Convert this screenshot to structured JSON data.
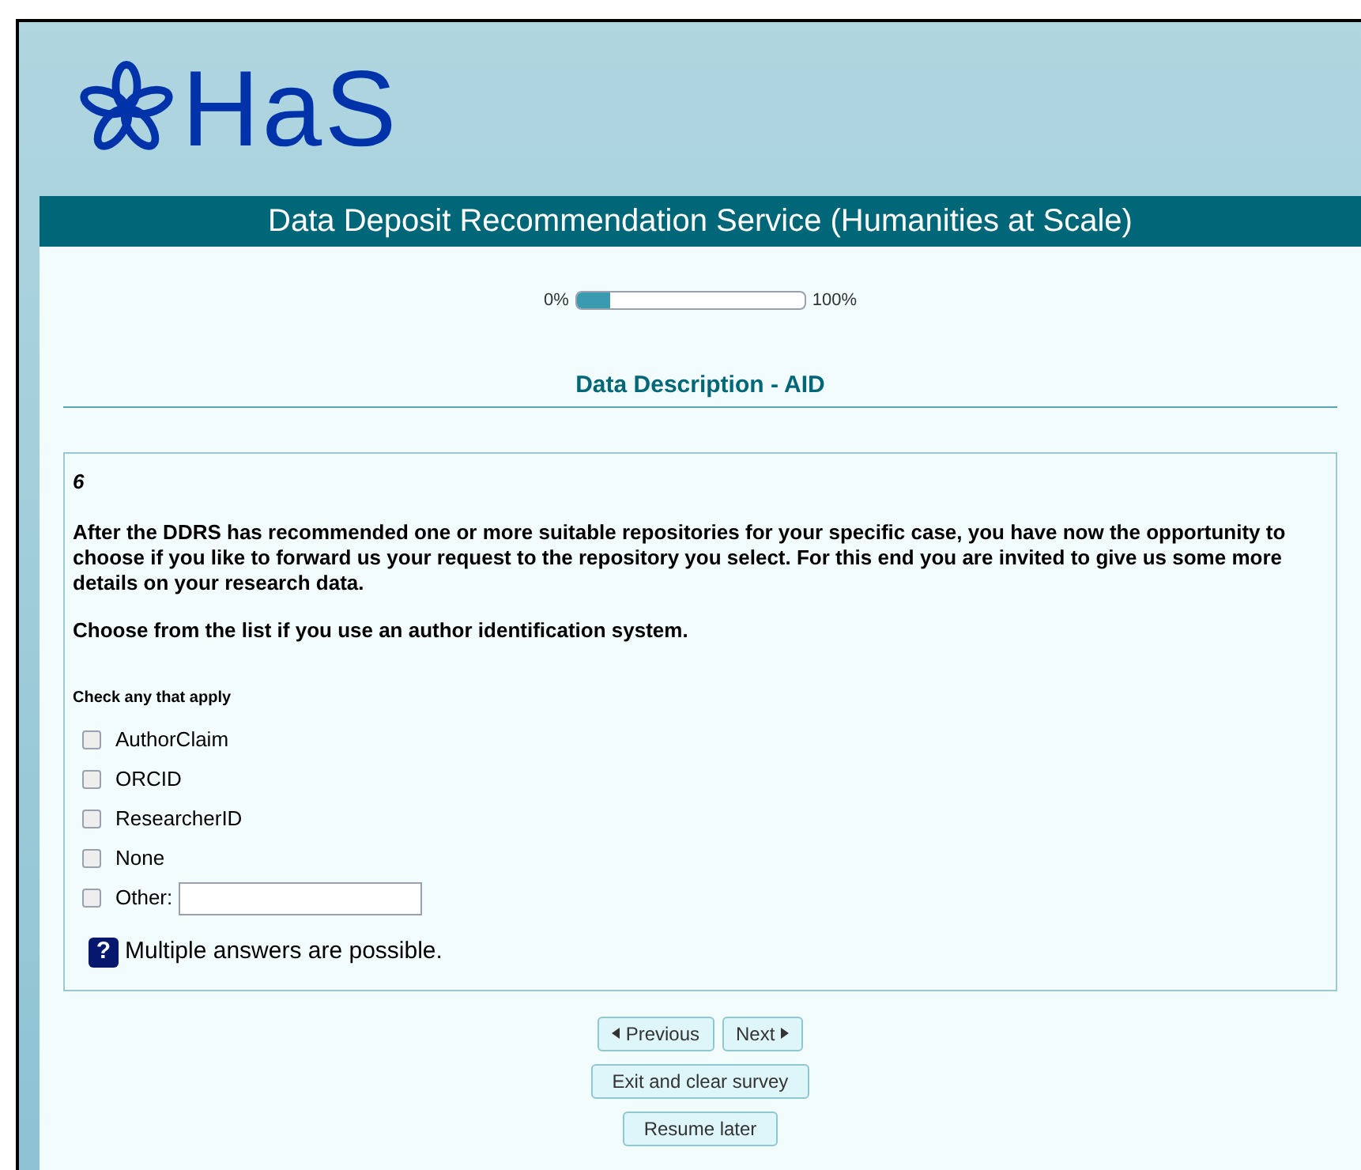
{
  "logo": {
    "text": "HaS"
  },
  "header": {
    "title": "Data Deposit Recommendation Service (Humanities at Scale)"
  },
  "progress": {
    "start_label": "0%",
    "end_label": "100%",
    "level": 0.15
  },
  "section": {
    "title": "Data Description - AID"
  },
  "question": {
    "number": "6",
    "intro": "After the DDRS has recommended one or more suitable repositories for your specific case, you have now the opportunity to choose if you like to forward us your request to the repository you select. For this end you are invited to give us some more details on your research data.",
    "prompt": "Choose from the list if you use an author identification system.",
    "instruction": "Check any that apply",
    "options": [
      {
        "kind": "plain",
        "label": "AuthorClaim",
        "checked": false
      },
      {
        "kind": "plain",
        "label": "ORCID",
        "checked": false
      },
      {
        "kind": "plain",
        "label": "ResearcherID",
        "checked": false
      },
      {
        "kind": "plain",
        "label": "None",
        "checked": false
      },
      {
        "kind": "other",
        "label": "Other:",
        "checked": false
      }
    ],
    "help_icon": "?",
    "help": "Multiple answers are possible."
  },
  "buttons": {
    "previous": "Previous",
    "next": "Next",
    "exit": "Exit and clear survey",
    "resume": "Resume later"
  }
}
